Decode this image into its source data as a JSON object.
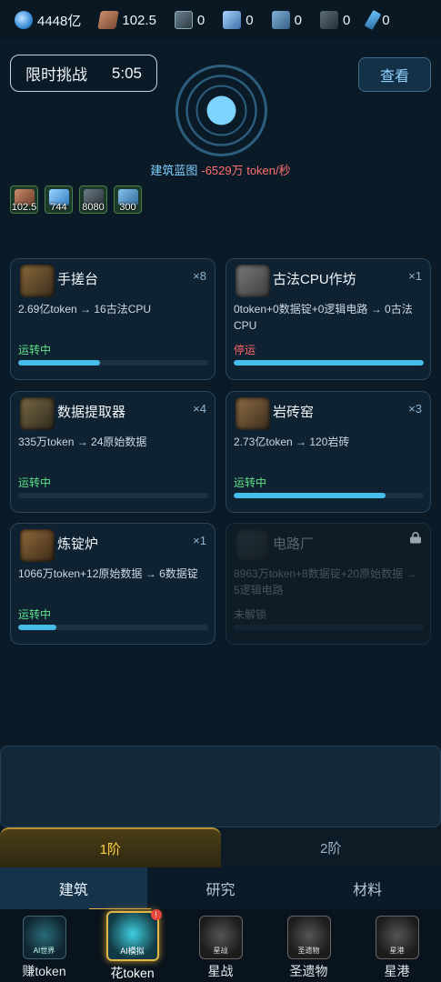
{
  "resources": [
    {
      "icon": "crystal-icon",
      "value": "4448亿"
    },
    {
      "icon": "plate-icon",
      "value": "102.5"
    },
    {
      "icon": "chip-icon",
      "value": "0"
    },
    {
      "icon": "cube-icon",
      "value": "0"
    },
    {
      "icon": "bar-icon",
      "value": "0"
    },
    {
      "icon": "circuit-board-icon",
      "value": "0"
    },
    {
      "icon": "key-icon",
      "value": "0"
    }
  ],
  "challenge": {
    "label": "限时挑战",
    "timer": "5:05"
  },
  "view_button": "查看",
  "blueprint": {
    "label": "建筑蓝图",
    "rate": "-6529万 token/秒"
  },
  "inventory": [
    {
      "icon": "plate-icon",
      "count": "102.5"
    },
    {
      "icon": "crystal-icon",
      "count": "744"
    },
    {
      "icon": "chip-icon",
      "count": "8080"
    },
    {
      "icon": "bar-icon",
      "count": "300"
    }
  ],
  "buildings": [
    {
      "name": "手搓台",
      "count": "×8",
      "recipe": "2.69亿token → 16古法CPU",
      "status": "运转中",
      "progress": 0.43
    },
    {
      "name": "古法CPU作坊",
      "count": "×1",
      "recipe": "0token+0数据锭+0逻辑电路 → 0古法CPU",
      "status": "停运",
      "progress": 1.0
    },
    {
      "name": "数据提取器",
      "count": "×4",
      "recipe": "335万token → 24原始数据",
      "status": "运转中",
      "progress": 0.0
    },
    {
      "name": "岩砖窑",
      "count": "×3",
      "recipe": "2.73亿token → 120岩砖",
      "status": "运转中",
      "progress": 0.8
    },
    {
      "name": "炼锭炉",
      "count": "×1",
      "recipe": "1066万token+12原始数据 → 6数据锭",
      "status": "运转中",
      "progress": 0.2
    },
    {
      "name": "电路厂",
      "count": "",
      "recipe": "8963万token+8数据锭+20原始数据 → 5逻辑电路",
      "status": "未解锁",
      "progress": 0.0
    }
  ],
  "tiers": [
    "1阶",
    "2阶"
  ],
  "tabs": [
    "建筑",
    "研究",
    "材料"
  ],
  "nav": [
    {
      "label": "赚token",
      "icon_caption": "AI世界",
      "icon": "ai-world-icon"
    },
    {
      "label": "花token",
      "icon_caption": "AI模拟",
      "icon": "ai-sim-icon",
      "badge": "!"
    },
    {
      "label": "星战",
      "icon_caption": "星战",
      "icon": "lock-icon"
    },
    {
      "label": "圣遗物",
      "icon_caption": "圣遗物",
      "icon": "lock-icon"
    },
    {
      "label": "星港",
      "icon_caption": "星港",
      "icon": "lock-icon"
    }
  ]
}
